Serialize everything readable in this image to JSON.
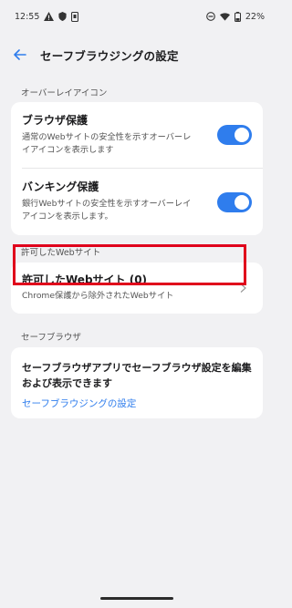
{
  "status_bar": {
    "time": "12:55",
    "battery": "22%",
    "left_icons": [
      "warning-icon",
      "shield-icon",
      "phone-icon"
    ],
    "right_icons": [
      "do-not-disturb-icon",
      "wifi-icon",
      "battery-icon"
    ]
  },
  "header": {
    "title": "セーフブラウジングの設定",
    "back_icon": "back-arrow-icon"
  },
  "sections": {
    "overlay": {
      "label": "オーバーレイアイコン",
      "items": [
        {
          "title": "ブラウザ保護",
          "desc": "通常のWebサイトの安全性を示すオーバーレイアイコンを表示します",
          "enabled": true
        },
        {
          "title": "バンキング保護",
          "desc": "銀行Webサイトの安全性を示すオーバーレイアイコンを表示します。",
          "enabled": true
        }
      ]
    },
    "allowed": {
      "label": "許可したWebサイト",
      "item": {
        "title": "許可したWebサイト (0)",
        "desc": "Chrome保護から除外されたWebサイト"
      }
    },
    "safe_browser": {
      "label": "セーフブラウザ",
      "text": "セーフブラウザアプリでセーフブラウザ設定を編集および表示できます",
      "link": "セーフブラウジングの設定"
    }
  },
  "colors": {
    "accent": "#2f7ded",
    "highlight": "#e0001b",
    "background": "#f1f1f3"
  }
}
